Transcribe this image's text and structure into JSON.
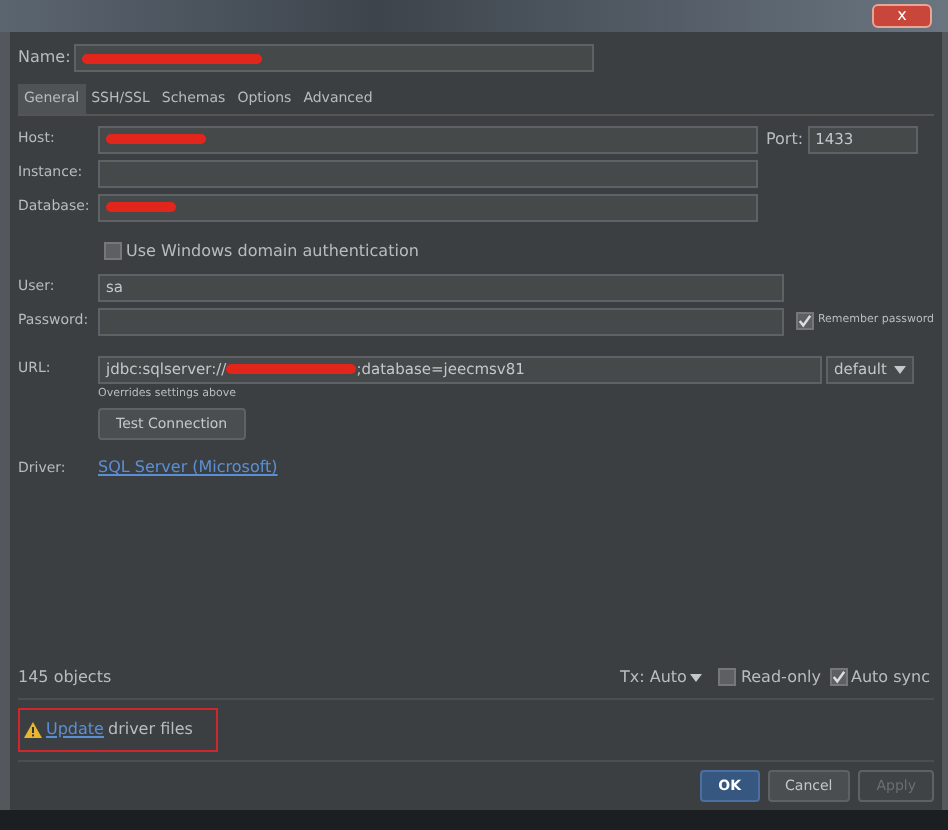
{
  "window": {
    "close": "x"
  },
  "name_field": {
    "label": "Name:",
    "redacted": true
  },
  "tabs": [
    {
      "label": "General",
      "selected": true
    },
    {
      "label": "SSH/SSL",
      "selected": false
    },
    {
      "label": "Schemas",
      "selected": false
    },
    {
      "label": "Options",
      "selected": false
    },
    {
      "label": "Advanced",
      "selected": false
    }
  ],
  "host": {
    "label": "Host:",
    "redacted": true
  },
  "port": {
    "label": "Port:",
    "value": "1433"
  },
  "instance": {
    "label": "Instance:"
  },
  "database": {
    "label": "Database:",
    "redacted": true
  },
  "windows_auth": {
    "label": "Use Windows domain authentication",
    "checked": false
  },
  "user": {
    "label": "User:",
    "value": "sa"
  },
  "password": {
    "label": "Password:"
  },
  "remember_password": {
    "label": "Remember password",
    "checked": true
  },
  "url": {
    "label": "URL:",
    "prefix": "jdbc:sqlserver://",
    "suffix": ";database=jeecmsv81",
    "mode": "default",
    "hint": "Overrides settings above"
  },
  "test_button": "Test Connection",
  "driver": {
    "label": "Driver:",
    "link": "SQL Server (Microsoft)"
  },
  "status": {
    "objects": "145 objects",
    "tx": "Tx: Auto",
    "read_only": {
      "label": "Read-only",
      "checked": false
    },
    "auto_sync": {
      "label": "Auto sync",
      "checked": true
    }
  },
  "warning": {
    "link": "Update",
    "text": "driver files",
    "highlighted": true
  },
  "buttons": [
    {
      "label": "OK",
      "kind": "primary",
      "disabled": false
    },
    {
      "label": "Cancel",
      "kind": "normal",
      "disabled": false
    },
    {
      "label": "Apply",
      "kind": "normal",
      "disabled": true
    }
  ]
}
